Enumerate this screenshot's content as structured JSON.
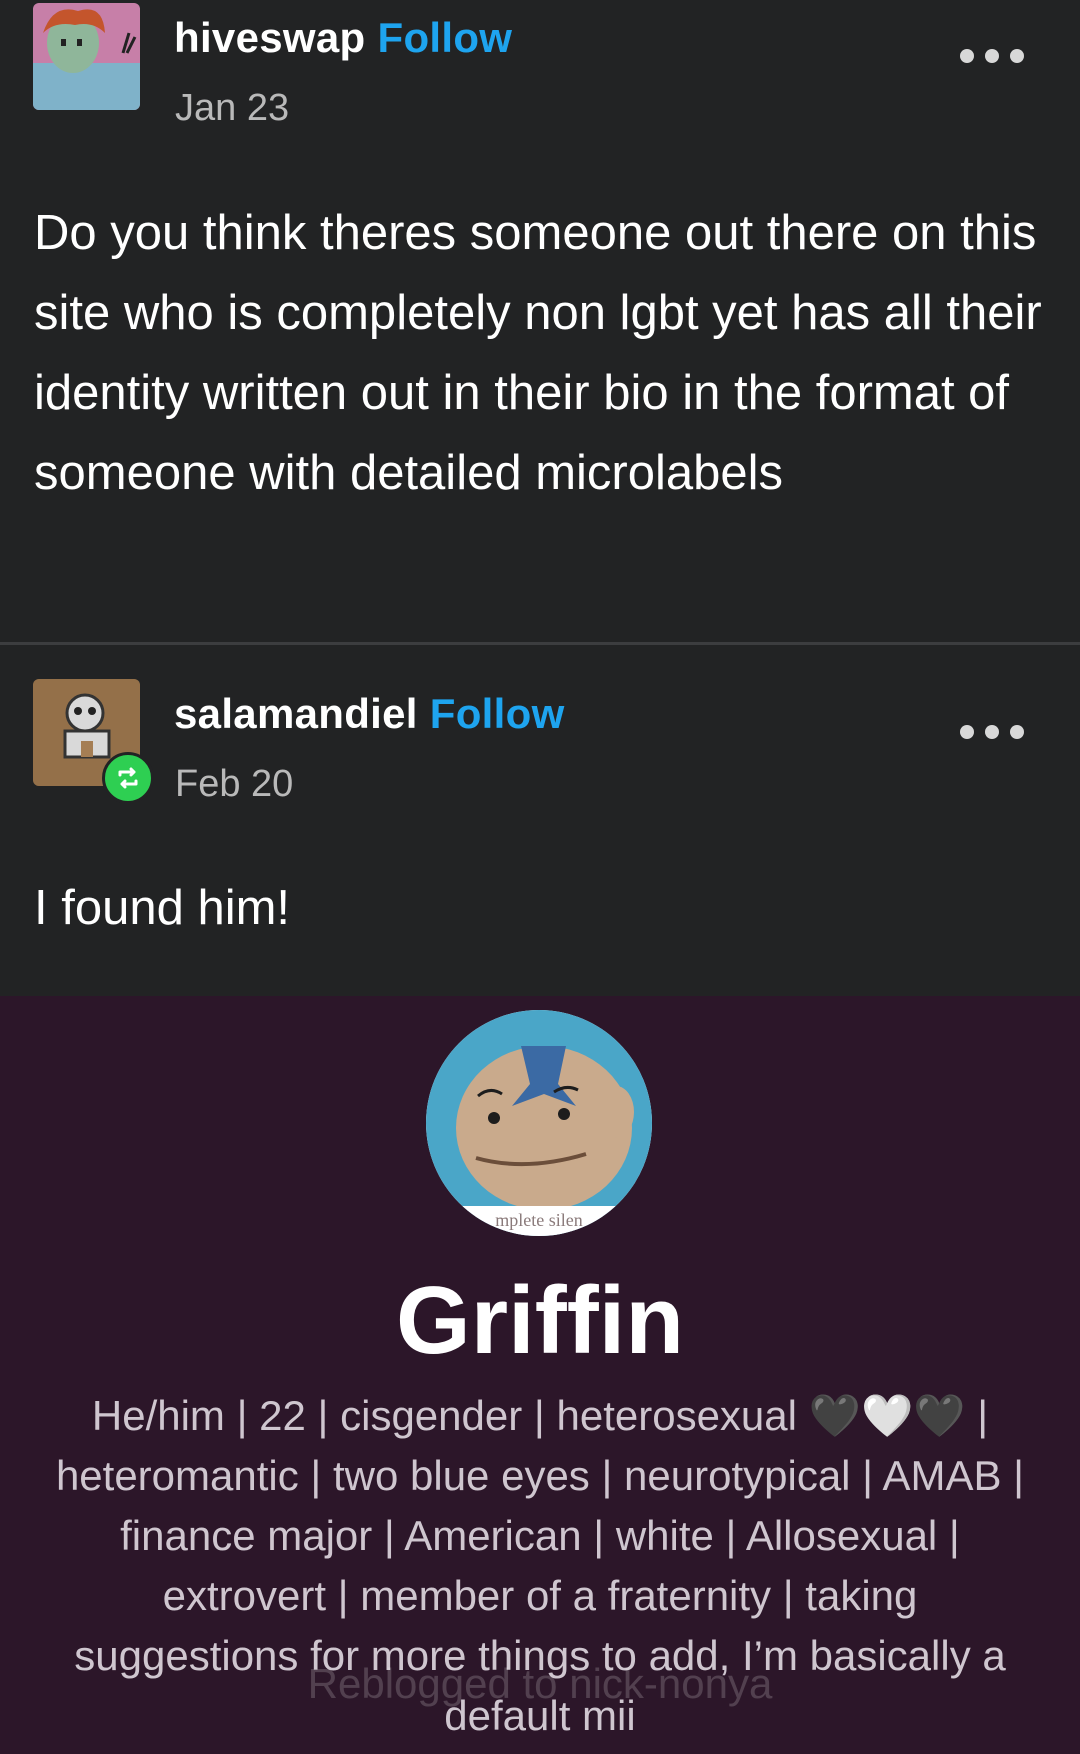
{
  "posts": [
    {
      "username": "hiveswap",
      "follow_label": "Follow",
      "date": "Jan 23",
      "text": "Do you think theres someone out there on this site who is completely non lgbt yet has all their identity written out in their bio in the format of someone with detailed microlabels"
    },
    {
      "username": "salamandiel",
      "follow_label": "Follow",
      "date": "Feb 20",
      "text": "I found him!"
    }
  ],
  "profile": {
    "avatar_caption": "mplete silen",
    "name": "Griffin",
    "bio": "He/him | 22 | cisgender | heterosexual 🖤🤍🖤 | heteromantic | two blue eyes | neurotypical | AMAB | finance major | American | white | Allosexual | extrovert | member of a fraternity | taking suggestions for more things to add, I’m basically a default mii",
    "watermark": "Reblogged to nick-nonya"
  },
  "colors": {
    "background": "#222324",
    "follow": "#1ea4ef",
    "profile_background": "#2c1629",
    "reblog_badge": "#2ecf52"
  },
  "icons": [
    "more-options-icon",
    "reblog-icon"
  ]
}
